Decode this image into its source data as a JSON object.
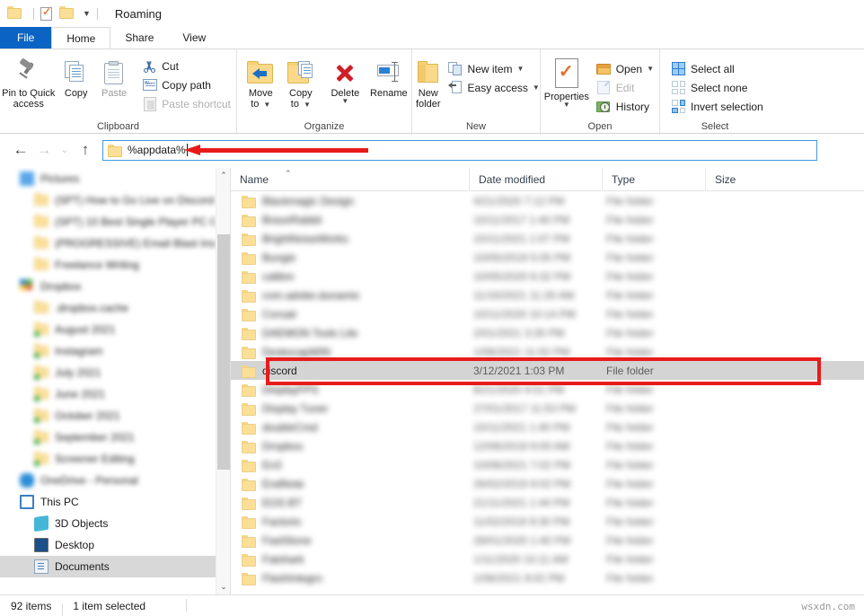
{
  "window": {
    "title": "Roaming",
    "quick_access_icons": [
      "folder-icon",
      "properties-icon",
      "new-folder-icon",
      "customize-caret-icon"
    ]
  },
  "tabs": [
    {
      "label": "File",
      "id": "file"
    },
    {
      "label": "Home",
      "id": "home"
    },
    {
      "label": "Share",
      "id": "share"
    },
    {
      "label": "View",
      "id": "view"
    }
  ],
  "active_tab": "Home",
  "ribbon": {
    "groups": [
      {
        "name": "Clipboard",
        "label": "Clipboard",
        "big_buttons": [
          {
            "label": "Pin to Quick\naccess",
            "line1": "Pin to Quick",
            "line2": "access",
            "icon": "pin-icon"
          },
          {
            "label": "Copy",
            "line1": "Copy",
            "line2": "",
            "icon": "copy-icon"
          },
          {
            "label": "Paste",
            "line1": "Paste",
            "line2": "",
            "icon": "paste-icon"
          }
        ],
        "small_buttons": [
          {
            "label": "Cut",
            "icon": "scissors-icon",
            "disabled": false
          },
          {
            "label": "Copy path",
            "icon": "copy-path-icon",
            "disabled": false
          },
          {
            "label": "Paste shortcut",
            "icon": "paste-shortcut-icon",
            "disabled": true
          }
        ]
      },
      {
        "name": "Organize",
        "label": "Organize",
        "big_buttons": [
          {
            "line1": "Move",
            "line2": "to",
            "icon": "move-to-icon",
            "dropdown": true
          },
          {
            "line1": "Copy",
            "line2": "to",
            "icon": "copy-to-icon",
            "dropdown": true
          },
          {
            "line1": "Delete",
            "line2": "",
            "icon": "delete-icon",
            "dropdown": true
          },
          {
            "line1": "Rename",
            "line2": "",
            "icon": "rename-icon",
            "dropdown": false
          }
        ]
      },
      {
        "name": "New",
        "label": "New",
        "big_buttons": [
          {
            "line1": "New",
            "line2": "folder",
            "icon": "new-folder-icon"
          }
        ],
        "small_buttons": [
          {
            "label": "New item",
            "icon": "new-item-icon",
            "dropdown": true
          },
          {
            "label": "Easy access",
            "icon": "easy-access-icon",
            "dropdown": true
          }
        ]
      },
      {
        "name": "Open",
        "label": "Open",
        "big_buttons": [
          {
            "line1": "Properties",
            "line2": "",
            "icon": "properties-icon",
            "dropdown": true
          }
        ],
        "small_buttons": [
          {
            "label": "Open",
            "icon": "open-folder-icon",
            "dropdown": true,
            "disabled": false
          },
          {
            "label": "Edit",
            "icon": "edit-icon",
            "dropdown": false,
            "disabled": true
          },
          {
            "label": "History",
            "icon": "history-icon",
            "dropdown": false,
            "disabled": false
          }
        ]
      },
      {
        "name": "Select",
        "label": "Select",
        "small_buttons": [
          {
            "label": "Select all",
            "icon": "select-all-icon"
          },
          {
            "label": "Select none",
            "icon": "select-none-icon"
          },
          {
            "label": "Invert selection",
            "icon": "invert-selection-icon"
          }
        ]
      }
    ]
  },
  "address_bar": {
    "back_icon": "back-arrow-icon",
    "forward_icon": "forward-arrow-icon",
    "recent_icon": "chevron-down-icon",
    "up_icon": "up-arrow-icon",
    "value": "%appdata%",
    "folder_icon": "folder-icon",
    "annotation": "red-arrow-pointing-to-address"
  },
  "nav_pane": {
    "items": [
      {
        "label": "Pictures",
        "icon": "pictures-icon",
        "indent": 0,
        "blur": true
      },
      {
        "label": "(SPT) How to Go Live on Discord",
        "icon": "folder-icon",
        "indent": 1,
        "blur": true
      },
      {
        "label": "(SPT) 10 Best Single Player PC Games for",
        "icon": "folder-icon",
        "indent": 1,
        "blur": true
      },
      {
        "label": "(PROGRESSIVE) Email Blast Images",
        "icon": "folder-icon",
        "indent": 1,
        "blur": true
      },
      {
        "label": "Freelance Writing",
        "icon": "folder-icon",
        "indent": 1,
        "blur": true
      },
      {
        "label": "Dropbox",
        "icon": "dropbox-icon",
        "indent": 0,
        "blur": true
      },
      {
        "label": ".dropbox.cache",
        "icon": "folder-icon",
        "indent": 1,
        "blur": true
      },
      {
        "label": "August 2021",
        "icon": "folder-sync-icon",
        "indent": 1,
        "blur": true
      },
      {
        "label": "Instagram",
        "icon": "folder-sync-icon",
        "indent": 1,
        "blur": true
      },
      {
        "label": "July 2021",
        "icon": "folder-sync-icon",
        "indent": 1,
        "blur": true
      },
      {
        "label": "June 2021",
        "icon": "folder-sync-icon",
        "indent": 1,
        "blur": true
      },
      {
        "label": "October 2021",
        "icon": "folder-sync-icon",
        "indent": 1,
        "blur": true
      },
      {
        "label": "September 2021",
        "icon": "folder-sync-icon",
        "indent": 1,
        "blur": true
      },
      {
        "label": "Screener Editing",
        "icon": "folder-sync-icon",
        "indent": 1,
        "blur": true
      },
      {
        "label": "OneDrive - Personal",
        "icon": "onedrive-icon",
        "indent": 0,
        "blur": true
      },
      {
        "label": "This PC",
        "icon": "this-pc-icon",
        "indent": 0,
        "blur": false
      },
      {
        "label": "3D Objects",
        "icon": "3d-objects-icon",
        "indent": 1,
        "blur": false
      },
      {
        "label": "Desktop",
        "icon": "desktop-icon",
        "indent": 1,
        "blur": false
      },
      {
        "label": "Documents",
        "icon": "documents-icon",
        "indent": 1,
        "blur": false,
        "selected": true
      }
    ],
    "scrollbar": {
      "up_icon": "scroll-up-icon",
      "down_icon": "scroll-down-icon"
    }
  },
  "file_list": {
    "columns": [
      {
        "label": "Name",
        "sorted": true,
        "sort_icon": "sort-ascending-icon"
      },
      {
        "label": "Date modified"
      },
      {
        "label": "Type"
      },
      {
        "label": "Size"
      }
    ],
    "rows": [
      {
        "name": "Blackmagic Design",
        "date": "4/21/2020 7:12 PM",
        "type": "File folder",
        "size": "",
        "blur": true
      },
      {
        "name": "BraveRabbit",
        "date": "10/11/2017 1:40 PM",
        "type": "File folder",
        "size": "",
        "blur": true
      },
      {
        "name": "BrightNoiseWorks",
        "date": "10/11/2021 1:07 PM",
        "type": "File folder",
        "size": "",
        "blur": true
      },
      {
        "name": "Bungie",
        "date": "10/05/2019 5:05 PM",
        "type": "File folder",
        "size": "",
        "blur": true
      },
      {
        "name": "calibre",
        "date": "10/05/2020 6:32 PM",
        "type": "File folder",
        "size": "",
        "blur": true
      },
      {
        "name": "com.adobe.dunamis",
        "date": "11/16/2021 11:26 AM",
        "type": "File folder",
        "size": "",
        "blur": true
      },
      {
        "name": "Corsair",
        "date": "10/11/2020 10:14 PM",
        "type": "File folder",
        "size": "",
        "blur": true
      },
      {
        "name": "DAEMON Tools Lite",
        "date": "2/01/2021 3:26 PM",
        "type": "File folder",
        "size": "",
        "blur": true
      },
      {
        "name": "DeskscapWIN",
        "date": "1/08/2021 11:02 PM",
        "type": "File folder",
        "size": "",
        "blur": true
      },
      {
        "name": "discord",
        "date": "3/12/2021 1:03 PM",
        "type": "File folder",
        "size": "",
        "blur": false,
        "selected": true
      },
      {
        "name": "DisplayFPS",
        "date": "8/21/2020 4:51 PM",
        "type": "File folder",
        "size": "",
        "blur": true
      },
      {
        "name": "Display Tuner",
        "date": "27/01/2017 11:53 PM",
        "type": "File folder",
        "size": "",
        "blur": true
      },
      {
        "name": "doubleCmd",
        "date": "10/11/2021 1:40 PM",
        "type": "File folder",
        "size": "",
        "blur": true
      },
      {
        "name": "Dropbox",
        "date": "12/06/2019 9:00 AM",
        "type": "File folder",
        "size": "",
        "blur": true
      },
      {
        "name": " En3",
        "date": "10/08/2021 7:02 PM",
        "type": "File folder",
        "size": "",
        "blur": true
      },
      {
        "name": "EndNote",
        "date": "26/02/2019 9:02 PM",
        "type": "File folder",
        "size": "",
        "blur": true
      },
      {
        "name": "EOS BT",
        "date": "21/11/2021 1:44 PM",
        "type": "File folder",
        "size": "",
        "blur": true
      },
      {
        "name": "Factorio",
        "date": "11/02/2019 9:30 PM",
        "type": "File folder",
        "size": "",
        "blur": true
      },
      {
        "name": "FastStone",
        "date": "28/01/2020 1:40 PM",
        "type": "File folder",
        "size": "",
        "blur": true
      },
      {
        "name": "Fatshark",
        "date": "1/11/2020 10:11 AM",
        "type": "File folder",
        "size": "",
        "blur": true
      },
      {
        "name": "FlashIntegro",
        "date": "1/08/2021 9:02 PM",
        "type": "File folder",
        "size": "",
        "blur": true
      }
    ],
    "selection_annotation": "red-box-around-discord-row"
  },
  "status_bar": {
    "items_count": "92 items",
    "selection": "1 item selected"
  },
  "watermark": "wsxdn.com",
  "colors": {
    "accent_blue": "#0b64c4",
    "annotation_red": "#e81b1b",
    "selection_gray": "#d4d4d4",
    "folder_yellow": "#fbdf96"
  }
}
